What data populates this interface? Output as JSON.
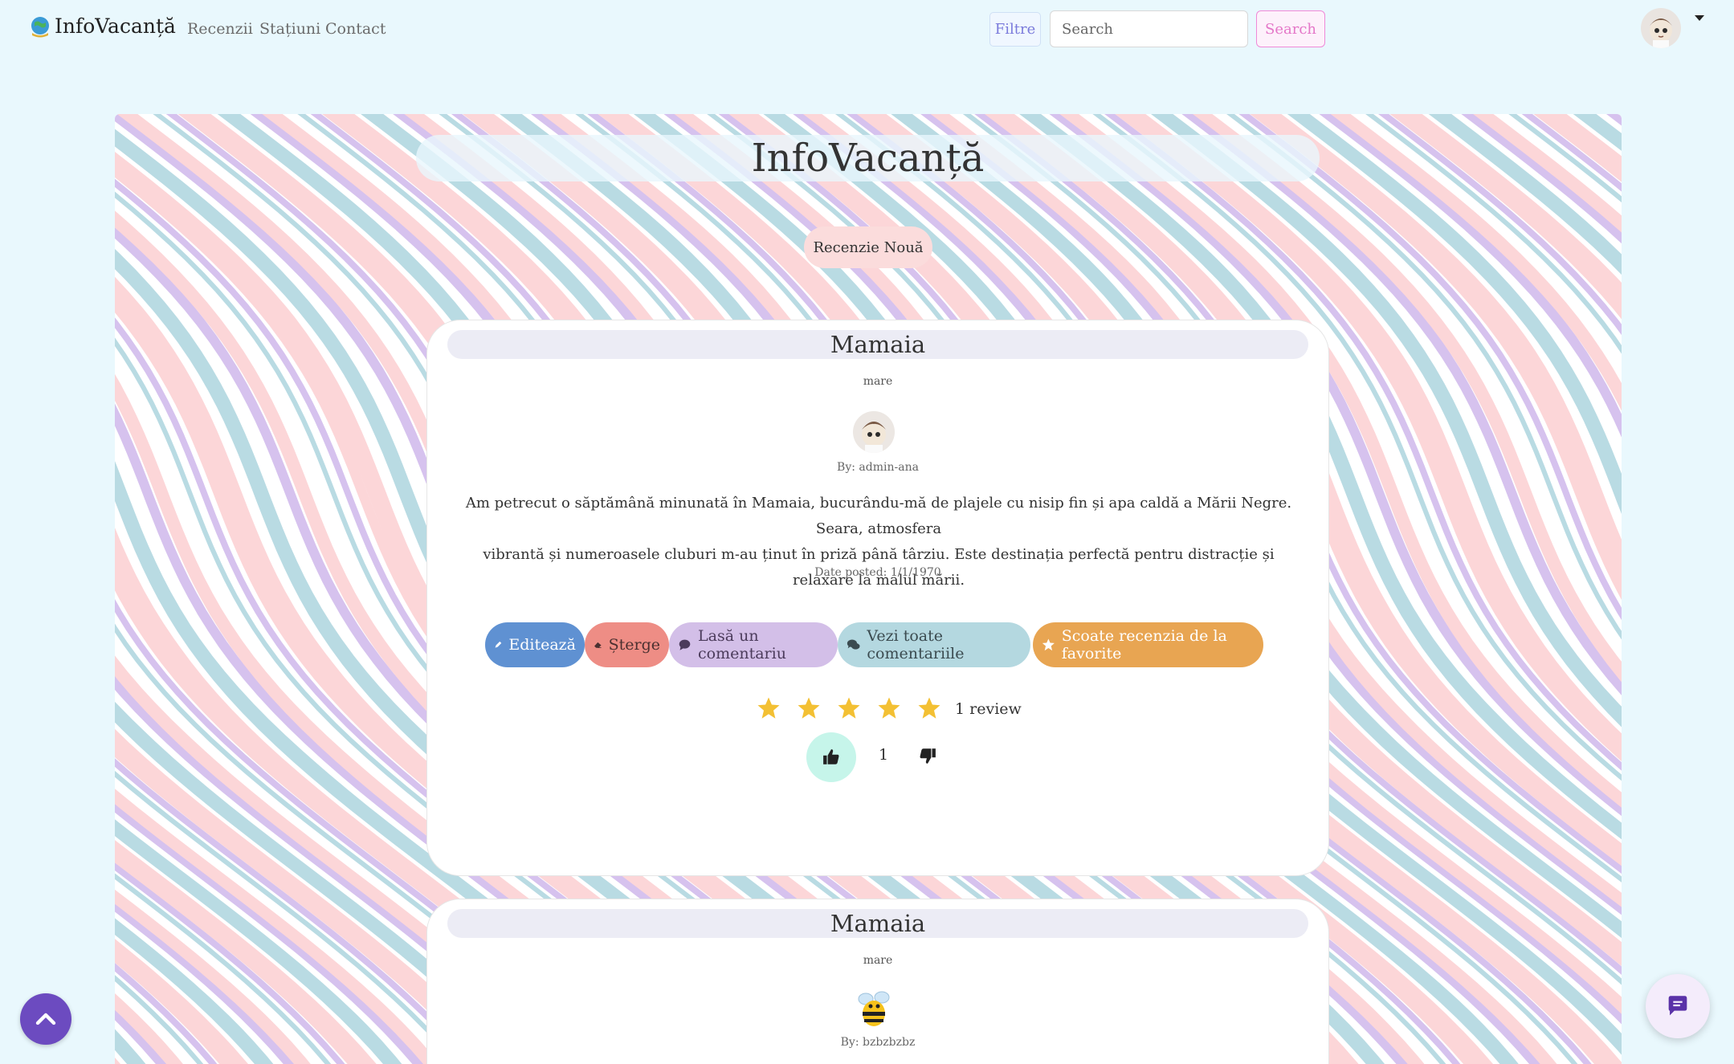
{
  "nav": {
    "brand": "InfoVacanță",
    "links": [
      "Recenzii",
      "Stațiuni",
      "Contact"
    ],
    "filter_label": "Filtre",
    "search_placeholder": "Search",
    "search_button": "Search"
  },
  "hero": {
    "title": "InfoVacanță",
    "new_review_button": "Recenzie Nouă"
  },
  "reviews": [
    {
      "title": "Mamaia",
      "category": "mare",
      "author": "By: admin-ana",
      "body_line1": "Am petrecut o săptămână minunată în Mamaia, bucurându-mă de plajele cu nisip fin și apa caldă a Mării Negre. Seara, atmosfera",
      "body_line2": "vibrantă și numeroasele cluburi m-au ținut în priză până târziu. Este destinația perfectă pentru distracție și relaxare la malul mării.",
      "date": "Date posted: 1/1/1970",
      "actions": {
        "edit": "Editează",
        "delete": "Șterge",
        "comment": "Lasă un comentariu",
        "view_comments": "Vezi toate comentariile",
        "unfavorite": "Scoate recenzia de la favorite"
      },
      "rating": 5,
      "review_count": "1 review",
      "likes": "1"
    },
    {
      "title": "Mamaia",
      "category": "mare",
      "author": "By: bzbzbzbz"
    }
  ],
  "colors": {
    "page_bg": "#e9f8fd",
    "accent_pink": "#e477c8",
    "edit": "#5f91d2",
    "delete": "#ee8d85",
    "comment": "#d3bfe8",
    "view": "#b4d8e0",
    "favorite": "#e8a552",
    "star": "#f3c033",
    "scroll_top": "#6c4bc0"
  },
  "icons": [
    "globe-logo-icon",
    "caret-down-icon",
    "pencil-icon",
    "eraser-icon",
    "comment-icon",
    "comments-icon",
    "star-icon",
    "thumbs-up-icon",
    "thumbs-down-icon",
    "chevron-up-icon",
    "chat-icon"
  ]
}
